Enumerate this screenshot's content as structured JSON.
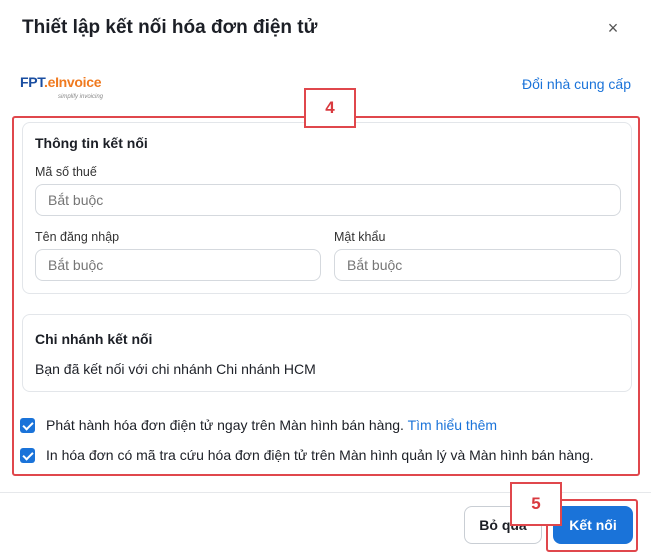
{
  "dialog": {
    "title": "Thiết lập kết nối hóa đơn điện tử",
    "close_symbol": "×"
  },
  "provider": {
    "logo_brand": "FPT",
    "logo_e": ".e",
    "logo_product": "Invoice",
    "logo_tagline": "simplify invoicing",
    "change_link": "Đổi nhà cung cấp"
  },
  "connection_info": {
    "title": "Thông tin kết nối",
    "tax_code_label": "Mã số thuế",
    "tax_code_placeholder": "Bắt buộc",
    "username_label": "Tên đăng nhập",
    "username_placeholder": "Bắt buộc",
    "password_label": "Mật khẩu",
    "password_placeholder": "Bắt buộc"
  },
  "branch": {
    "title": "Chi nhánh kết nối",
    "text": "Bạn đã kết nối với chi nhánh Chi nhánh HCM"
  },
  "options": [
    {
      "label": "Phát hành hóa đơn điện tử ngay trên Màn hình bán hàng.",
      "link": "Tìm hiểu thêm",
      "checked": true
    },
    {
      "label": "In hóa đơn có mã tra cứu hóa đơn điện tử trên Màn hình quản lý và Màn hình bán hàng.",
      "checked": true
    }
  ],
  "annotations": {
    "step4": "4",
    "step5": "5",
    "color": "#e0474c"
  },
  "footer": {
    "skip_label": "Bỏ qua",
    "connect_label": "Kết nối"
  },
  "colors": {
    "accent": "#1a73d9"
  }
}
